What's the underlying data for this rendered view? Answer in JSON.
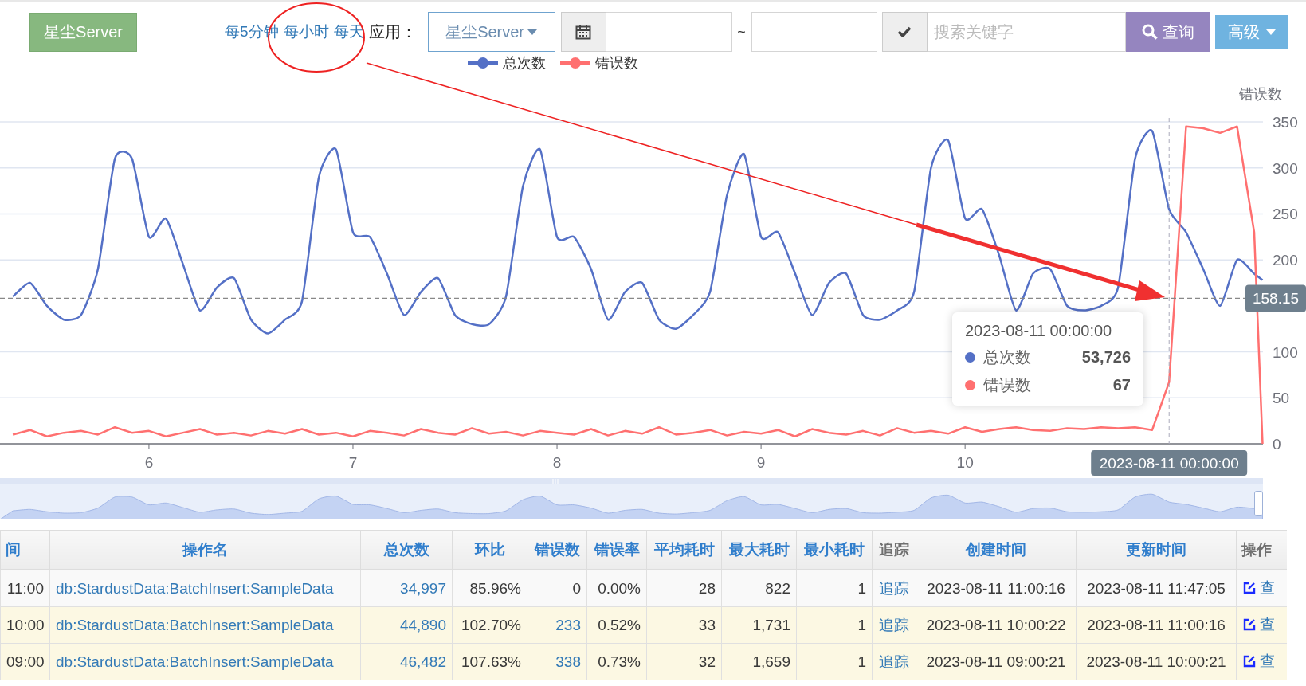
{
  "toolbar": {
    "app_button": "星尘Server",
    "intervals": [
      {
        "label": "每5分钟",
        "selected": false
      },
      {
        "label": "每小时",
        "selected": false
      },
      {
        "label": "每天",
        "selected": false
      }
    ],
    "app_label": "应用：",
    "app_select": "星尘Server",
    "date_separator": "~",
    "search": {
      "placeholder": "搜索关键字"
    },
    "query_button": "查询",
    "advanced_button": "高级"
  },
  "chart": {
    "tooltip": {
      "title": "2023-08-11 00:00:00",
      "items": [
        {
          "name": "总次数",
          "value": "53,726"
        },
        {
          "name": "错误数",
          "value": "67"
        }
      ]
    },
    "chart_data": {
      "type": "line",
      "ylabel": "错误数",
      "xlim": [
        5.27,
        11.46
      ],
      "ylim": [
        0,
        350
      ],
      "xticks": [
        6,
        7,
        8,
        9,
        10
      ],
      "yticks": [
        0,
        50,
        100,
        200,
        250,
        300,
        350
      ],
      "x": [
        5.333,
        5.417,
        5.5,
        5.583,
        5.667,
        5.75,
        5.833,
        5.917,
        6,
        6.083,
        6.167,
        6.25,
        6.333,
        6.417,
        6.5,
        6.583,
        6.667,
        6.75,
        6.833,
        6.917,
        7,
        7.083,
        7.167,
        7.25,
        7.333,
        7.417,
        7.5,
        7.583,
        7.667,
        7.75,
        7.833,
        7.917,
        8,
        8.083,
        8.167,
        8.25,
        8.333,
        8.417,
        8.5,
        8.583,
        8.667,
        8.75,
        8.833,
        8.917,
        9,
        9.083,
        9.167,
        9.25,
        9.333,
        9.417,
        9.5,
        9.583,
        9.667,
        9.75,
        9.833,
        9.917,
        10,
        10.083,
        10.167,
        10.25,
        10.333,
        10.417,
        10.5,
        10.583,
        10.667,
        10.75,
        10.833,
        10.917,
        11,
        11.083,
        11.167,
        11.25,
        11.333,
        11.417,
        11.458
      ],
      "series": [
        {
          "name": "总次数",
          "color": "#5470c6",
          "values": [
            160,
            175,
            150,
            135,
            140,
            190,
            310,
            310,
            225,
            245,
            195,
            145,
            170,
            180,
            135,
            120,
            135,
            155,
            290,
            320,
            230,
            225,
            185,
            140,
            165,
            180,
            140,
            130,
            130,
            160,
            280,
            320,
            225,
            225,
            190,
            135,
            165,
            175,
            135,
            125,
            140,
            165,
            270,
            315,
            225,
            230,
            185,
            140,
            175,
            185,
            140,
            135,
            145,
            165,
            300,
            330,
            245,
            255,
            205,
            145,
            185,
            190,
            150,
            145,
            150,
            170,
            310,
            340,
            255,
            230,
            190,
            150,
            200,
            185,
            178
          ]
        },
        {
          "name": "错误数",
          "color": "#ff7070",
          "values": [
            10,
            15,
            8,
            12,
            14,
            10,
            18,
            12,
            14,
            8,
            12,
            16,
            10,
            12,
            9,
            14,
            11,
            16,
            10,
            12,
            8,
            14,
            12,
            9,
            16,
            12,
            10,
            17,
            11,
            13,
            9,
            14,
            12,
            10,
            16,
            9,
            14,
            11,
            18,
            10,
            12,
            15,
            9,
            13,
            11,
            15,
            8,
            16,
            12,
            10,
            14,
            9,
            17,
            12,
            14,
            11,
            18,
            13,
            16,
            18,
            15,
            14,
            17,
            16,
            18,
            17,
            18,
            15,
            67,
            345,
            343,
            338,
            345,
            230,
            0
          ]
        }
      ],
      "ref_lines": [
        {
          "axis": "y",
          "value": 158.15,
          "label": "158.15"
        },
        {
          "axis": "x",
          "value": 11
        }
      ],
      "grid": true,
      "legend": true
    },
    "pointer_label": "2023-08-11 00:00:00"
  },
  "range_slider": {
    "level": 1
  },
  "table": {
    "columns": [
      {
        "label": "间",
        "sortable": true
      },
      {
        "label": "操作名",
        "sortable": true
      },
      {
        "label": "总次数",
        "sortable": true
      },
      {
        "label": "环比",
        "sortable": true
      },
      {
        "label": "错误数",
        "sortable": true
      },
      {
        "label": "错误率",
        "sortable": true
      },
      {
        "label": "平均耗时",
        "sortable": true
      },
      {
        "label": "最大耗时",
        "sortable": true
      },
      {
        "label": "最小耗时",
        "sortable": true
      },
      {
        "label": "追踪",
        "sortable": false
      },
      {
        "label": "创建时间",
        "sortable": true
      },
      {
        "label": "更新时间",
        "sortable": true
      },
      {
        "label": "操作",
        "sortable": false
      }
    ],
    "rows": [
      {
        "highlighted": false,
        "cells": [
          "11:00",
          {
            "text": "db:StardustData:BatchInsert:SampleData",
            "link": true
          },
          {
            "text": "34,997",
            "link": true
          },
          "85.96%",
          "0",
          "0.00%",
          "28",
          "822",
          "1",
          {
            "text": "追踪",
            "link": true
          },
          "2023-08-11 11:00:16",
          "2023-08-11 11:47:05",
          {
            "text": "查",
            "link": true,
            "kind": "edit"
          }
        ]
      },
      {
        "highlighted": true,
        "cells": [
          "10:00",
          {
            "text": "db:StardustData:BatchInsert:SampleData",
            "link": true
          },
          {
            "text": "44,890",
            "link": true
          },
          "102.70%",
          {
            "text": "233",
            "link": true
          },
          "0.52%",
          "33",
          "1,731",
          "1",
          {
            "text": "追踪",
            "link": true
          },
          "2023-08-11 10:00:22",
          "2023-08-11 11:00:16",
          {
            "text": "查",
            "link": true,
            "kind": "edit"
          }
        ]
      },
      {
        "highlighted": true,
        "cells": [
          "09:00",
          {
            "text": "db:StardustData:BatchInsert:SampleData",
            "link": true
          },
          {
            "text": "46,482",
            "link": true
          },
          "107.63%",
          {
            "text": "338",
            "link": true
          },
          "0.73%",
          "32",
          "1,659",
          "1",
          {
            "text": "追踪",
            "link": true
          },
          "2023-08-11 09:00:21",
          "2023-08-11 10:00:21",
          {
            "text": "查",
            "link": true,
            "kind": "edit"
          }
        ]
      }
    ]
  }
}
